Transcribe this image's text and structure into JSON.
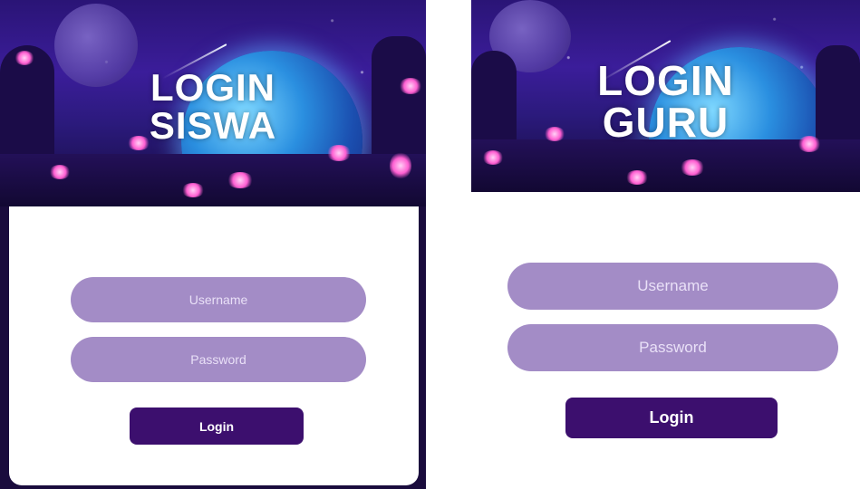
{
  "siswa": {
    "title_line1": "LOGIN",
    "title_line2": "SISWA",
    "username_placeholder": "Username",
    "password_placeholder": "Password",
    "login_label": "Login"
  },
  "guru": {
    "title_line1": "LOGIN",
    "title_line2": "GURU",
    "username_placeholder": "Username",
    "password_placeholder": "Password",
    "login_label": "Login"
  },
  "colors": {
    "field_background": "#a38cc6",
    "button_background": "#3c0f6e",
    "hero_sky": "#3b1d9a",
    "planet": "#2a8fe0",
    "glow": "#ff5fd2"
  }
}
